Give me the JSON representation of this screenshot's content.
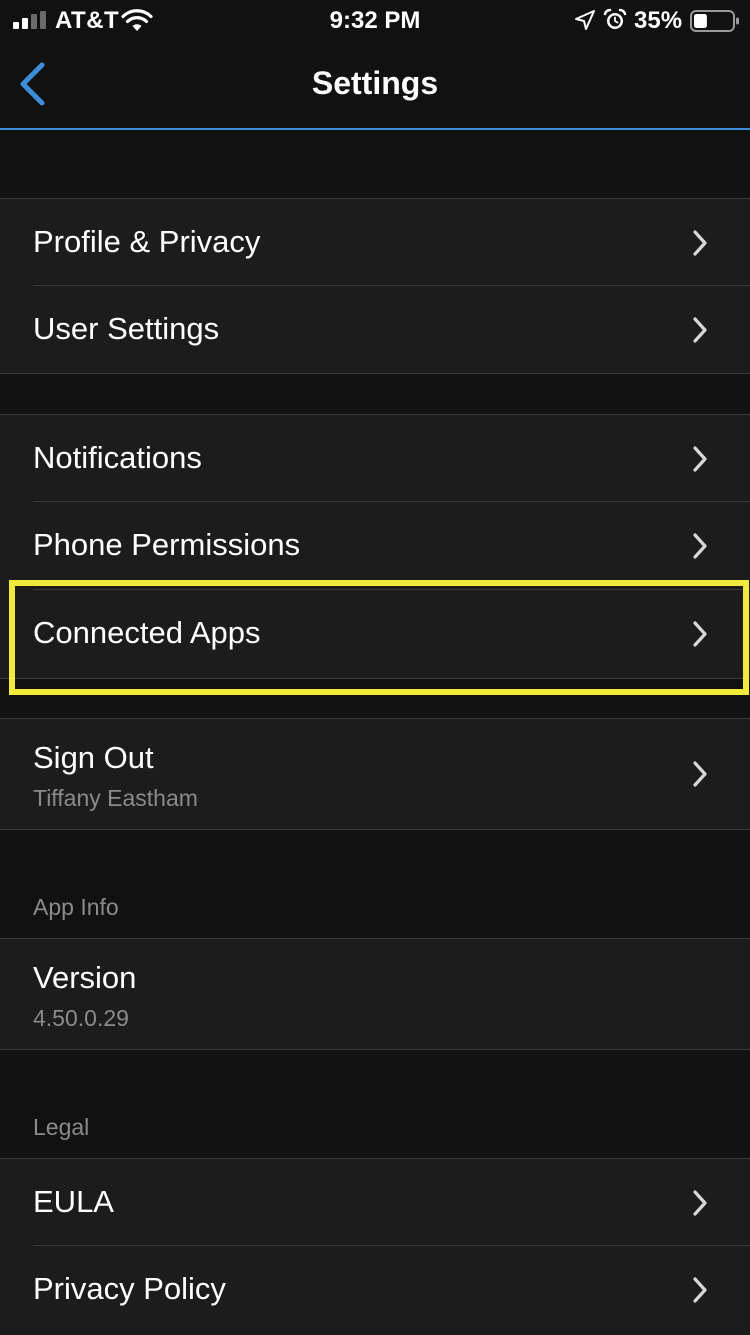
{
  "status_bar": {
    "carrier": "AT&T",
    "time": "9:32 PM",
    "battery": "35%",
    "battery_level": 0.35,
    "icons": [
      "signal-icon",
      "wifi-icon",
      "location-icon",
      "alarm-icon",
      "battery-icon"
    ]
  },
  "nav": {
    "title": "Settings",
    "back_icon": "chevron-left-icon",
    "accent_color": "#3d8ed8"
  },
  "groups": {
    "account": {
      "items": [
        {
          "label": "Profile & Privacy"
        },
        {
          "label": "User Settings"
        }
      ]
    },
    "device": {
      "items": [
        {
          "label": "Notifications"
        },
        {
          "label": "Phone Permissions"
        },
        {
          "label": "Connected Apps"
        }
      ]
    },
    "session": {
      "items": [
        {
          "label": "Sign Out",
          "sublabel": "Tiffany Eastham"
        }
      ]
    },
    "app_info": {
      "header": "App Info",
      "items": [
        {
          "label": "Version",
          "sublabel": "4.50.0.29"
        }
      ]
    },
    "legal": {
      "header": "Legal",
      "items": [
        {
          "label": "EULA"
        },
        {
          "label": "Privacy Policy"
        }
      ]
    }
  },
  "highlight": {
    "target": "Connected Apps",
    "color": "#f1ea3c"
  },
  "colors": {
    "background": "#111111",
    "cell": "#1c1c1c",
    "separator": "#3a3a3a",
    "secondary_text": "#8a8a8a"
  }
}
